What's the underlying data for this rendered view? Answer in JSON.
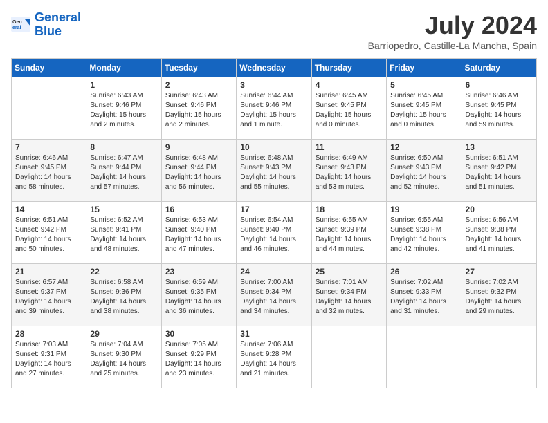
{
  "logo": {
    "line1": "General",
    "line2": "Blue"
  },
  "title": "July 2024",
  "location": "Barriopedro, Castille-La Mancha, Spain",
  "headers": [
    "Sunday",
    "Monday",
    "Tuesday",
    "Wednesday",
    "Thursday",
    "Friday",
    "Saturday"
  ],
  "weeks": [
    [
      {
        "day": "",
        "sunrise": "",
        "sunset": "",
        "daylight": ""
      },
      {
        "day": "1",
        "sunrise": "Sunrise: 6:43 AM",
        "sunset": "Sunset: 9:46 PM",
        "daylight": "Daylight: 15 hours and 2 minutes."
      },
      {
        "day": "2",
        "sunrise": "Sunrise: 6:43 AM",
        "sunset": "Sunset: 9:46 PM",
        "daylight": "Daylight: 15 hours and 2 minutes."
      },
      {
        "day": "3",
        "sunrise": "Sunrise: 6:44 AM",
        "sunset": "Sunset: 9:46 PM",
        "daylight": "Daylight: 15 hours and 1 minute."
      },
      {
        "day": "4",
        "sunrise": "Sunrise: 6:45 AM",
        "sunset": "Sunset: 9:45 PM",
        "daylight": "Daylight: 15 hours and 0 minutes."
      },
      {
        "day": "5",
        "sunrise": "Sunrise: 6:45 AM",
        "sunset": "Sunset: 9:45 PM",
        "daylight": "Daylight: 15 hours and 0 minutes."
      },
      {
        "day": "6",
        "sunrise": "Sunrise: 6:46 AM",
        "sunset": "Sunset: 9:45 PM",
        "daylight": "Daylight: 14 hours and 59 minutes."
      }
    ],
    [
      {
        "day": "7",
        "sunrise": "Sunrise: 6:46 AM",
        "sunset": "Sunset: 9:45 PM",
        "daylight": "Daylight: 14 hours and 58 minutes."
      },
      {
        "day": "8",
        "sunrise": "Sunrise: 6:47 AM",
        "sunset": "Sunset: 9:44 PM",
        "daylight": "Daylight: 14 hours and 57 minutes."
      },
      {
        "day": "9",
        "sunrise": "Sunrise: 6:48 AM",
        "sunset": "Sunset: 9:44 PM",
        "daylight": "Daylight: 14 hours and 56 minutes."
      },
      {
        "day": "10",
        "sunrise": "Sunrise: 6:48 AM",
        "sunset": "Sunset: 9:43 PM",
        "daylight": "Daylight: 14 hours and 55 minutes."
      },
      {
        "day": "11",
        "sunrise": "Sunrise: 6:49 AM",
        "sunset": "Sunset: 9:43 PM",
        "daylight": "Daylight: 14 hours and 53 minutes."
      },
      {
        "day": "12",
        "sunrise": "Sunrise: 6:50 AM",
        "sunset": "Sunset: 9:43 PM",
        "daylight": "Daylight: 14 hours and 52 minutes."
      },
      {
        "day": "13",
        "sunrise": "Sunrise: 6:51 AM",
        "sunset": "Sunset: 9:42 PM",
        "daylight": "Daylight: 14 hours and 51 minutes."
      }
    ],
    [
      {
        "day": "14",
        "sunrise": "Sunrise: 6:51 AM",
        "sunset": "Sunset: 9:42 PM",
        "daylight": "Daylight: 14 hours and 50 minutes."
      },
      {
        "day": "15",
        "sunrise": "Sunrise: 6:52 AM",
        "sunset": "Sunset: 9:41 PM",
        "daylight": "Daylight: 14 hours and 48 minutes."
      },
      {
        "day": "16",
        "sunrise": "Sunrise: 6:53 AM",
        "sunset": "Sunset: 9:40 PM",
        "daylight": "Daylight: 14 hours and 47 minutes."
      },
      {
        "day": "17",
        "sunrise": "Sunrise: 6:54 AM",
        "sunset": "Sunset: 9:40 PM",
        "daylight": "Daylight: 14 hours and 46 minutes."
      },
      {
        "day": "18",
        "sunrise": "Sunrise: 6:55 AM",
        "sunset": "Sunset: 9:39 PM",
        "daylight": "Daylight: 14 hours and 44 minutes."
      },
      {
        "day": "19",
        "sunrise": "Sunrise: 6:55 AM",
        "sunset": "Sunset: 9:38 PM",
        "daylight": "Daylight: 14 hours and 42 minutes."
      },
      {
        "day": "20",
        "sunrise": "Sunrise: 6:56 AM",
        "sunset": "Sunset: 9:38 PM",
        "daylight": "Daylight: 14 hours and 41 minutes."
      }
    ],
    [
      {
        "day": "21",
        "sunrise": "Sunrise: 6:57 AM",
        "sunset": "Sunset: 9:37 PM",
        "daylight": "Daylight: 14 hours and 39 minutes."
      },
      {
        "day": "22",
        "sunrise": "Sunrise: 6:58 AM",
        "sunset": "Sunset: 9:36 PM",
        "daylight": "Daylight: 14 hours and 38 minutes."
      },
      {
        "day": "23",
        "sunrise": "Sunrise: 6:59 AM",
        "sunset": "Sunset: 9:35 PM",
        "daylight": "Daylight: 14 hours and 36 minutes."
      },
      {
        "day": "24",
        "sunrise": "Sunrise: 7:00 AM",
        "sunset": "Sunset: 9:34 PM",
        "daylight": "Daylight: 14 hours and 34 minutes."
      },
      {
        "day": "25",
        "sunrise": "Sunrise: 7:01 AM",
        "sunset": "Sunset: 9:34 PM",
        "daylight": "Daylight: 14 hours and 32 minutes."
      },
      {
        "day": "26",
        "sunrise": "Sunrise: 7:02 AM",
        "sunset": "Sunset: 9:33 PM",
        "daylight": "Daylight: 14 hours and 31 minutes."
      },
      {
        "day": "27",
        "sunrise": "Sunrise: 7:02 AM",
        "sunset": "Sunset: 9:32 PM",
        "daylight": "Daylight: 14 hours and 29 minutes."
      }
    ],
    [
      {
        "day": "28",
        "sunrise": "Sunrise: 7:03 AM",
        "sunset": "Sunset: 9:31 PM",
        "daylight": "Daylight: 14 hours and 27 minutes."
      },
      {
        "day": "29",
        "sunrise": "Sunrise: 7:04 AM",
        "sunset": "Sunset: 9:30 PM",
        "daylight": "Daylight: 14 hours and 25 minutes."
      },
      {
        "day": "30",
        "sunrise": "Sunrise: 7:05 AM",
        "sunset": "Sunset: 9:29 PM",
        "daylight": "Daylight: 14 hours and 23 minutes."
      },
      {
        "day": "31",
        "sunrise": "Sunrise: 7:06 AM",
        "sunset": "Sunset: 9:28 PM",
        "daylight": "Daylight: 14 hours and 21 minutes."
      },
      {
        "day": "",
        "sunrise": "",
        "sunset": "",
        "daylight": ""
      },
      {
        "day": "",
        "sunrise": "",
        "sunset": "",
        "daylight": ""
      },
      {
        "day": "",
        "sunrise": "",
        "sunset": "",
        "daylight": ""
      }
    ]
  ]
}
